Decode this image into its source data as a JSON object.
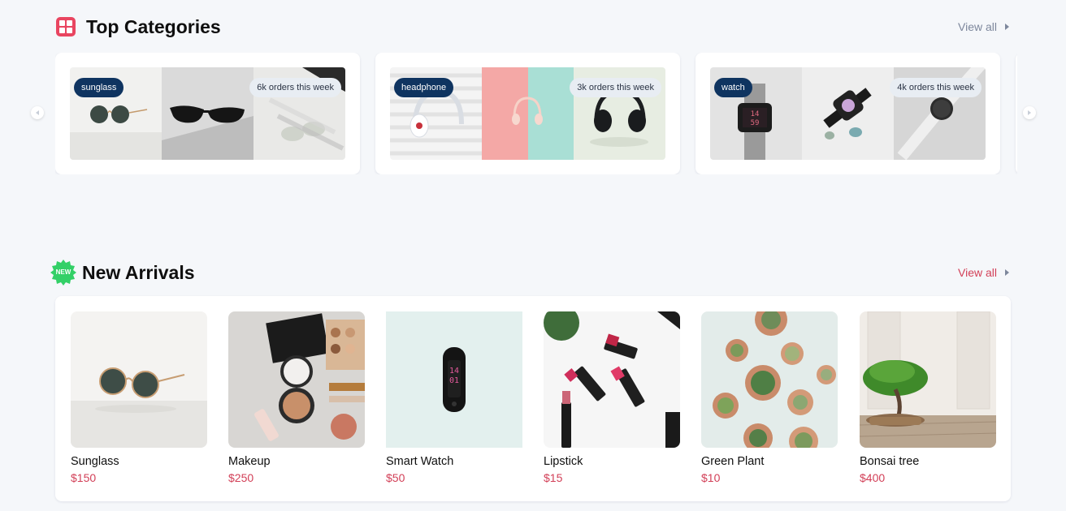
{
  "top_categories": {
    "title": "Top Categories",
    "view_all": "View all",
    "categories": [
      {
        "badge": "sunglass",
        "orders": "6k orders this week"
      },
      {
        "badge": "headphone",
        "orders": "3k orders this week"
      },
      {
        "badge": "watch",
        "orders": "4k orders this week"
      }
    ]
  },
  "new_arrivals": {
    "title": "New Arrivals",
    "new_badge": "NEW",
    "view_all": "View all",
    "products": [
      {
        "name": "Sunglass",
        "price": "$150"
      },
      {
        "name": "Makeup",
        "price": "$250"
      },
      {
        "name": "Smart Watch",
        "price": "$50"
      },
      {
        "name": "Lipstick",
        "price": "$15"
      },
      {
        "name": "Green Plant",
        "price": "$10"
      },
      {
        "name": "Bonsai tree",
        "price": "$400"
      }
    ]
  },
  "colors": {
    "accent": "#d23f57",
    "badge_navy": "#0f3460",
    "new_badge_green": "#33d067",
    "background": "#f5f7fa"
  },
  "icons": {
    "top_categories": "category-grid-icon",
    "new_arrivals": "new-badge-icon",
    "view_all": "caret-right-icon",
    "carousel_prev": "chevron-left-icon",
    "carousel_next": "chevron-right-icon"
  }
}
